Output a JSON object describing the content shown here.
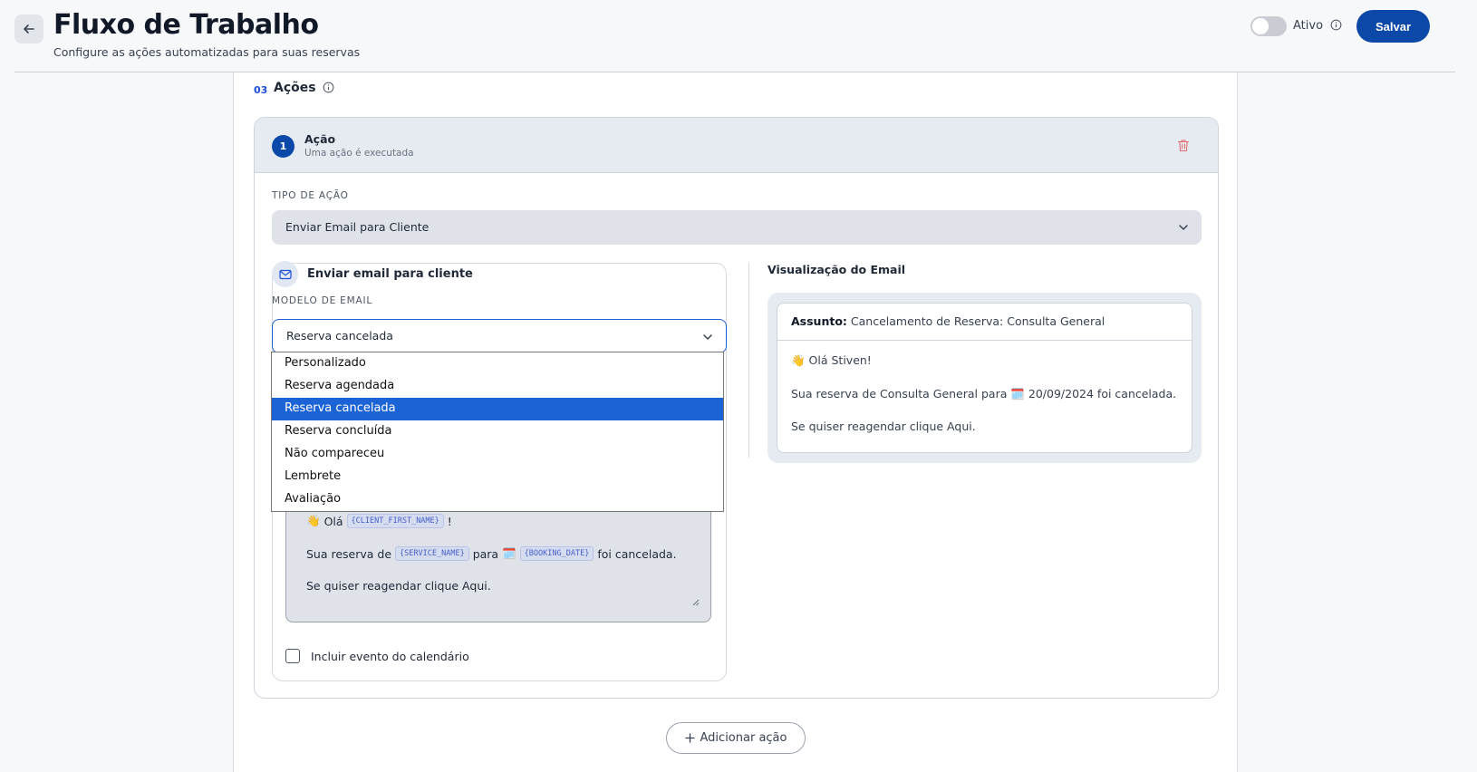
{
  "header": {
    "title": "Fluxo de Trabalho",
    "subtitle": "Configure as ações automatizadas para suas reservas",
    "toggle_label": "Ativo",
    "save_label": "Salvar"
  },
  "section": {
    "number": "03",
    "title": "Ações"
  },
  "action": {
    "badge": "1",
    "title": "Ação",
    "subtitle": "Uma ação é executada",
    "type_label": "TIPO DE AÇÃO",
    "type_value": "Enviar Email para Cliente",
    "email_section_title": "Enviar email para cliente",
    "template_label": "MODELO DE EMAIL",
    "template_value": "Reserva cancelada",
    "template_options": [
      "Personalizado",
      "Reserva agendada",
      "Reserva cancelada",
      "Reserva concluída",
      "Não compareceu",
      "Lembrete",
      "Avaliação"
    ],
    "selected_option_index": 2,
    "editor": {
      "greeting_emoji": "👋",
      "greeting": "Olá",
      "token_client": "{CLIENT_FIRST_NAME}",
      "exclaim": "!",
      "line2_start": "Sua reserva de",
      "token_service": "{SERVICE_NAME}",
      "line2_para": "para",
      "calendar_emoji": "🗓️",
      "token_date": "{BOOKING_DATE}",
      "line2_end": "foi cancelada.",
      "line3": "Se quiser reagendar clique Aqui."
    },
    "calendar_checkbox_label": "Incluir evento do calendário",
    "calendar_checked": false
  },
  "preview": {
    "title": "Visualização do Email",
    "subject_label": "Assunto:",
    "subject_value": "Cancelamento de Reserva: Consulta General",
    "line1": "👋 Olá Stiven!",
    "line2": "Sua reserva de Consulta General para 🗓️ 20/09/2024 foi cancelada.",
    "line3": "Se quiser reagendar clique Aqui."
  },
  "add_action_label": "Adicionar ação",
  "colors": {
    "primary": "#0b48a8",
    "selected_option": "#1c64d6",
    "trash": "#e26b6b"
  },
  "icons": [
    "arrow-left-icon",
    "info-icon",
    "trash-icon",
    "chevron-down-icon",
    "mail-icon",
    "plus-icon",
    "resize-handle-icon"
  ]
}
